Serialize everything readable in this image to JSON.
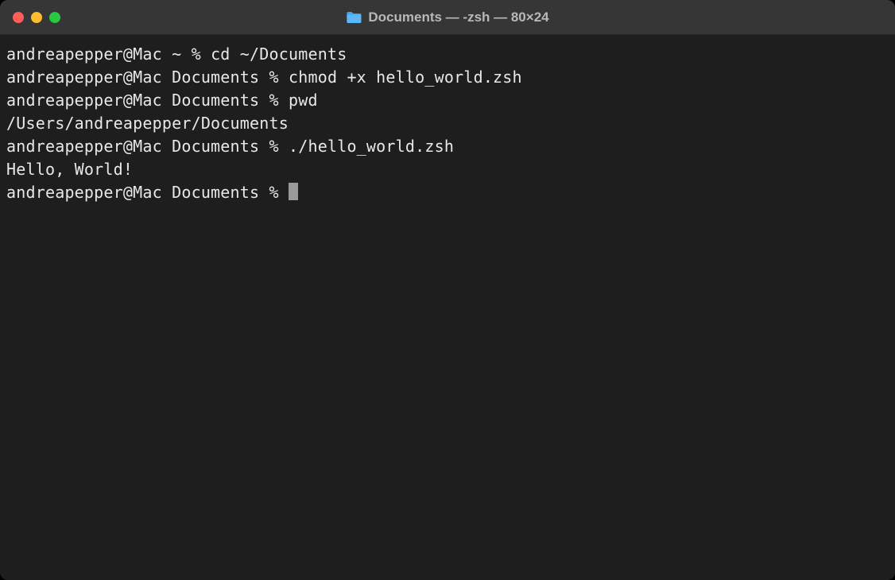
{
  "window": {
    "title": "Documents — -zsh — 80×24"
  },
  "terminal": {
    "lines": [
      {
        "prompt": "andreapepper@Mac ~ % ",
        "command": "cd ~/Documents"
      },
      {
        "prompt": "andreapepper@Mac Documents % ",
        "command": "chmod +x hello_world.zsh"
      },
      {
        "prompt": "andreapepper@Mac Documents % ",
        "command": "pwd"
      },
      {
        "output": "/Users/andreapepper/Documents"
      },
      {
        "prompt": "andreapepper@Mac Documents % ",
        "command": "./hello_world.zsh"
      },
      {
        "output": "Hello, World!"
      },
      {
        "prompt": "andreapepper@Mac Documents % ",
        "command": "",
        "cursor": true
      }
    ]
  }
}
